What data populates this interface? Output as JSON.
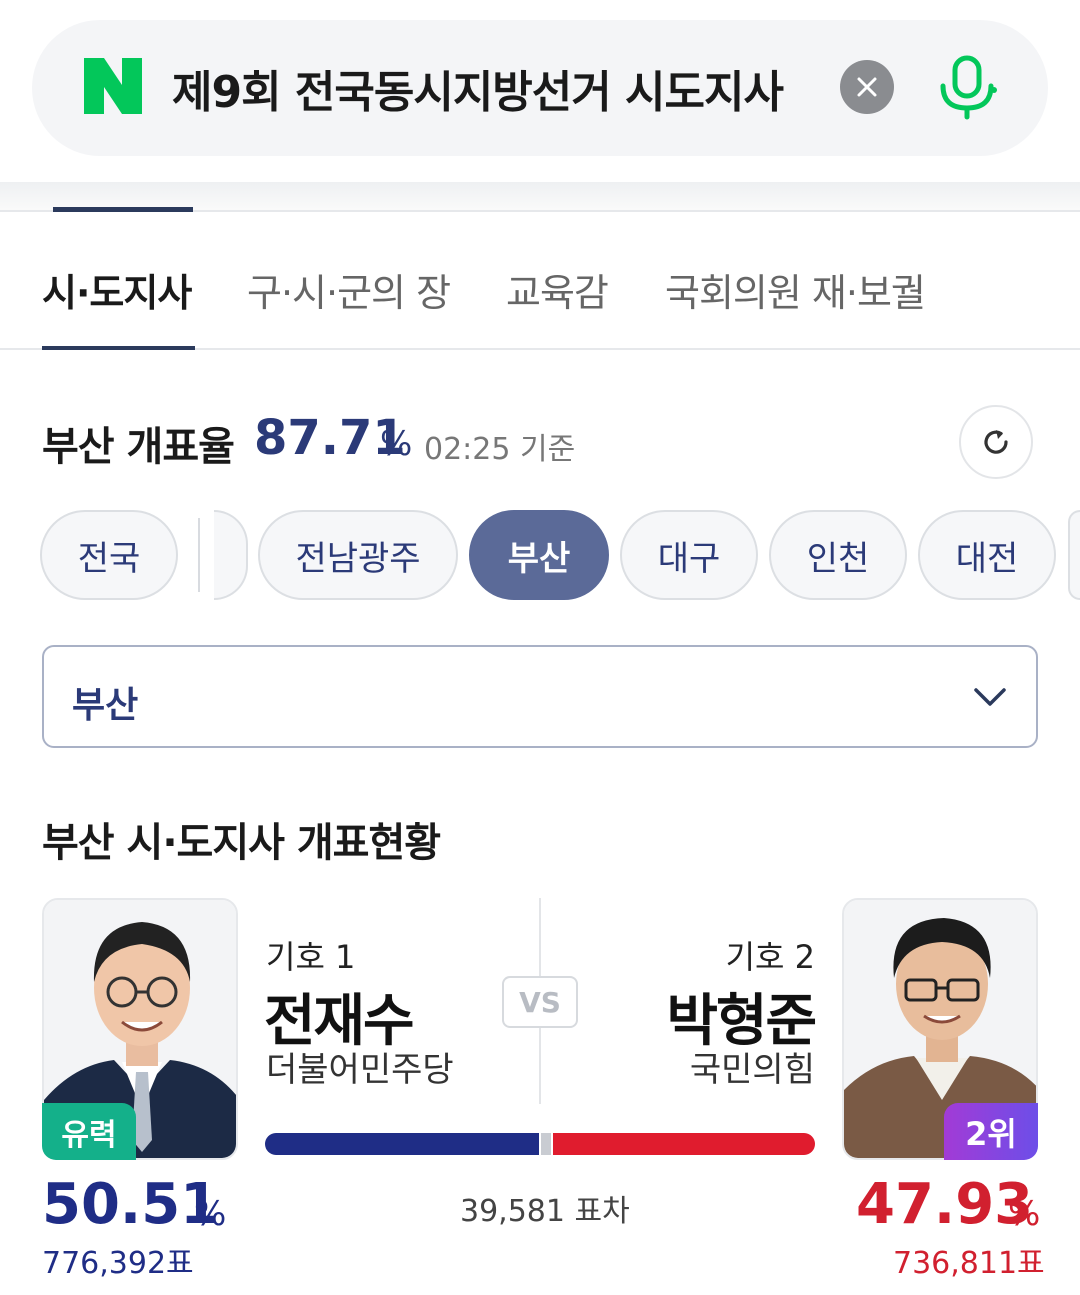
{
  "search": {
    "query": "제9회 전국동시지방선거 시도지사",
    "brand_color": "#03c75a"
  },
  "tabs": [
    {
      "label": "시·도지사",
      "active": true
    },
    {
      "label": "구·시·군의 장",
      "active": false
    },
    {
      "label": "교육감",
      "active": false
    },
    {
      "label": "국회의원 재·보궐",
      "active": false
    }
  ],
  "count": {
    "label": "부산 개표율",
    "rate": "87.71",
    "unit": "%",
    "time": "02:25 기준"
  },
  "regions": [
    {
      "label": "전국",
      "active": false
    },
    {
      "label": "전남광주",
      "active": false
    },
    {
      "label": "부산",
      "active": true
    },
    {
      "label": "대구",
      "active": false
    },
    {
      "label": "인천",
      "active": false
    },
    {
      "label": "대전",
      "active": false
    }
  ],
  "select": {
    "value": "부산"
  },
  "section_title": "부산 시·도지사 개표현황",
  "candidates": [
    {
      "number": "기호 1",
      "name": "전재수",
      "party": "더불어민주당",
      "badge": "유력",
      "percent": "50.51",
      "percent_unit": "%",
      "votes": "776,392표",
      "color": "#1f2d86"
    },
    {
      "number": "기호 2",
      "name": "박형준",
      "party": "국민의힘",
      "badge": "2위",
      "percent": "47.93",
      "percent_unit": "%",
      "votes": "736,811표",
      "color": "#d1202f"
    }
  ],
  "vs_label": "VS",
  "margin": "39,581 표차"
}
